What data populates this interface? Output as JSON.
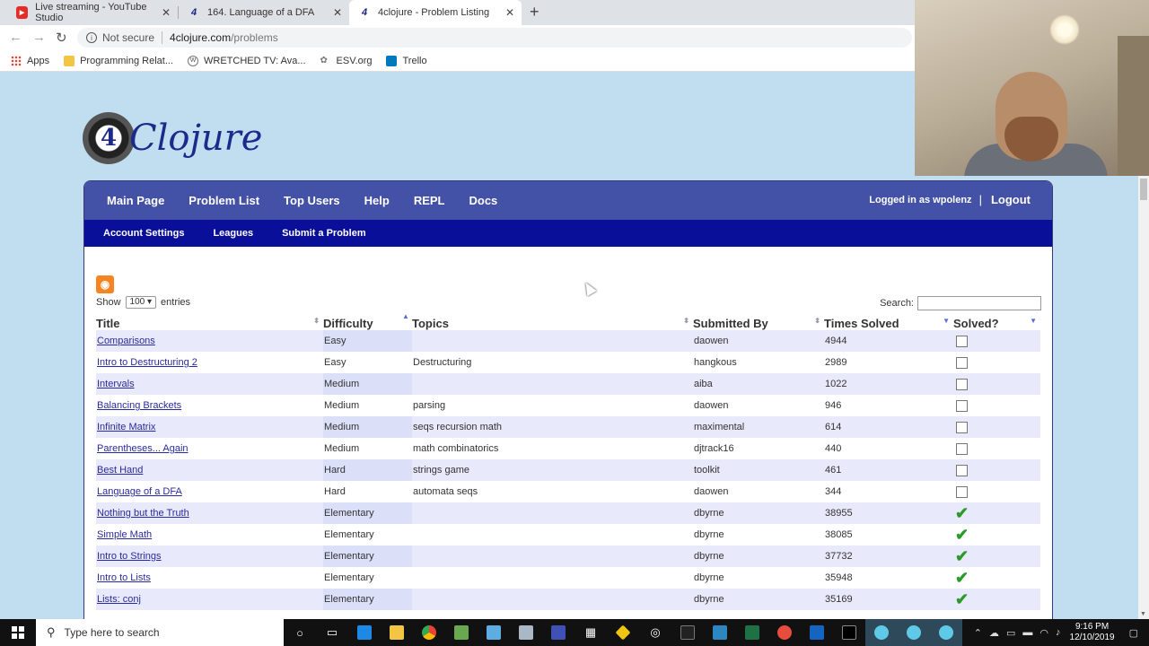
{
  "browser": {
    "tabs": [
      {
        "title": "Live streaming - YouTube Studio",
        "icon": "youtube-icon"
      },
      {
        "title": "164. Language of a DFA",
        "icon": "4clojure-icon"
      },
      {
        "title": "4clojure - Problem Listing",
        "icon": "4clojure-icon"
      }
    ],
    "security": "Not secure",
    "url_host": "4clojure.com",
    "url_path": "/problems",
    "bookmarks": [
      "Apps",
      "Programming Relat...",
      "WRETCHED TV: Ava...",
      "ESV.org",
      "Trello"
    ]
  },
  "site": {
    "logo_num": "4",
    "logo_text": "Clojure",
    "nav_primary": [
      "Main Page",
      "Problem List",
      "Top Users",
      "Help",
      "REPL",
      "Docs"
    ],
    "logged_in": "Logged in as wpolenz",
    "logout": "Logout",
    "nav_secondary": [
      "Account Settings",
      "Leagues",
      "Submit a Problem"
    ]
  },
  "listing": {
    "show_label": "Show",
    "entries_value": "100",
    "entries_label": "entries",
    "search_label": "Search:",
    "columns": [
      "Title",
      "Difficulty",
      "Topics",
      "Submitted By",
      "Times Solved",
      "Solved?"
    ],
    "rows": [
      {
        "title": "Comparisons",
        "difficulty": "Easy",
        "topics": "",
        "by": "daowen",
        "solved_count": "4944",
        "solved": false
      },
      {
        "title": "Intro to Destructuring 2",
        "difficulty": "Easy",
        "topics": "Destructuring",
        "by": "hangkous",
        "solved_count": "2989",
        "solved": false
      },
      {
        "title": "Intervals",
        "difficulty": "Medium",
        "topics": "",
        "by": "aiba",
        "solved_count": "1022",
        "solved": false
      },
      {
        "title": "Balancing Brackets",
        "difficulty": "Medium",
        "topics": "parsing",
        "by": "daowen",
        "solved_count": "946",
        "solved": false
      },
      {
        "title": "Infinite Matrix",
        "difficulty": "Medium",
        "topics": "seqs recursion math",
        "by": "maximental",
        "solved_count": "614",
        "solved": false
      },
      {
        "title": "Parentheses... Again",
        "difficulty": "Medium",
        "topics": "math combinatorics",
        "by": "djtrack16",
        "solved_count": "440",
        "solved": false
      },
      {
        "title": "Best Hand",
        "difficulty": "Hard",
        "topics": "strings game",
        "by": "toolkit",
        "solved_count": "461",
        "solved": false
      },
      {
        "title": "Language of a DFA",
        "difficulty": "Hard",
        "topics": "automata seqs",
        "by": "daowen",
        "solved_count": "344",
        "solved": false
      },
      {
        "title": "Nothing but the Truth",
        "difficulty": "Elementary",
        "topics": "",
        "by": "dbyrne",
        "solved_count": "38955",
        "solved": true
      },
      {
        "title": "Simple Math",
        "difficulty": "Elementary",
        "topics": "",
        "by": "dbyrne",
        "solved_count": "38085",
        "solved": true
      },
      {
        "title": "Intro to Strings",
        "difficulty": "Elementary",
        "topics": "",
        "by": "dbyrne",
        "solved_count": "37732",
        "solved": true
      },
      {
        "title": "Intro to Lists",
        "difficulty": "Elementary",
        "topics": "",
        "by": "dbyrne",
        "solved_count": "35948",
        "solved": true
      },
      {
        "title": "Lists: conj",
        "difficulty": "Elementary",
        "topics": "",
        "by": "dbyrne",
        "solved_count": "35169",
        "solved": true
      }
    ]
  },
  "taskbar": {
    "search_placeholder": "Type here to search",
    "time": "9:16 PM",
    "date": "12/10/2019"
  },
  "colors": {
    "page_bg": "#c1def0",
    "nav_primary_bg": "#4351a6",
    "nav_secondary_bg": "#0a0f99",
    "row_odd_bg": "#e8e9fb",
    "check_green": "#2b9a2b"
  }
}
